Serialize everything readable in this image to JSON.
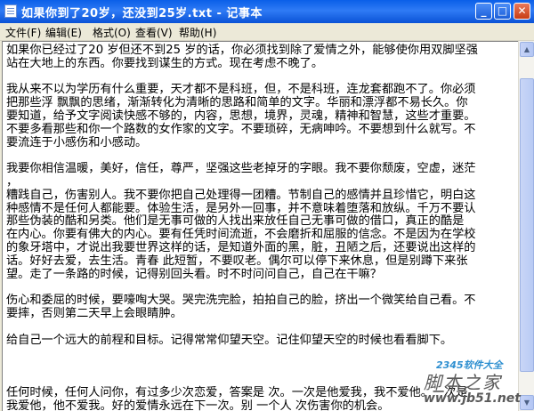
{
  "window": {
    "title": "如果你到了20岁，还没到25岁.txt - 记事本",
    "min_glyph": "_",
    "max_glyph": "□",
    "close_glyph": "✕"
  },
  "menu": {
    "items": [
      {
        "label": "文件(F)"
      },
      {
        "label": "编辑(E)"
      },
      {
        "label": "格式(O)"
      },
      {
        "label": "查看(V)"
      },
      {
        "label": "帮助(H)"
      }
    ]
  },
  "document": {
    "lines": [
      "如果你已经过了20 岁但还不到25 岁的话，你必须找到除了爱情之外，能够使你用双脚坚强",
      "站在大地上的东西。你要找到谋生的方式。现在考虑不晚了。",
      "",
      "我从来不以为学历有什么重要，天才都不是科班，但，不是科班，连龙套都跑不了。你必须",
      "把那些浮 飘飘的思绪，渐渐转化为清晰的思路和简单的文字。华丽和漂浮都不易长久。你",
      "要知道，给予文字阅读快感不够的，内容，思想，境界，灵魂，精神和智慧，这些才重要。",
      "不要多看那些和你一个路数的女作家的文字。不要琐碎，无病呻吟。不要想到什么就写。不",
      "要流连于小感伤和小感动。",
      "",
      "我要你相信温暖，美好，信任，尊严，坚强这些老掉牙的字眼。我不要你颓废，空虚，迷茫",
      "，",
      "糟践自己，伤害别人。我不要你把自己处理得一团糟。节制自己的感情并且珍惜它，明白这",
      "种感情不是任何人都能要。体验生活，是另外一回事，并不意味着堕落和放纵。千万不要认",
      "  那些伪装的酷和另类。他们是无事可做的人找出来放任自己无事可做的借口，真正的酷是",
      "在内心。你要有佛大的内心。要有任凭时间流逝，不会磨折和屈服的信念。不是因为在学校",
      "的象牙塔中，才说出我要世界这样的话，是知道外面的黑，脏，丑陋之后，还要说出这样的",
      "话。好好去爱，去生活。青春 此短暂，不要叹老。偶尔可以停下来休息，但是别蹲下来张",
      "望。走了一条路的时候，记得别回头看。时不时问问自己，自己在干嘛？",
      "",
      "伤心和委屈的时候，要嚎啕大哭。哭完洗完脸，拍拍自己的脸，挤出一个微笑给自己看。不",
      "要摔，否则第二天早上会眼睛肿。",
      "",
      "给自己一个远大的前程和目标。记得常常仰望天空。记住仰望天空的时候也看看脚下。",
      "",
      "",
      "",
      "任何时候，任何人问你，有过多少次恋爱，答案是 次。一次是他爱我，我不爱他。一次是",
      "我爱他，他不爱我。好的爱情永远在下一次。别  一个人 次伤害你的机会。"
    ]
  },
  "watermark": {
    "logo": "2345软件大全",
    "chinese": "脚本之家",
    "url": "www.jb51.net"
  }
}
